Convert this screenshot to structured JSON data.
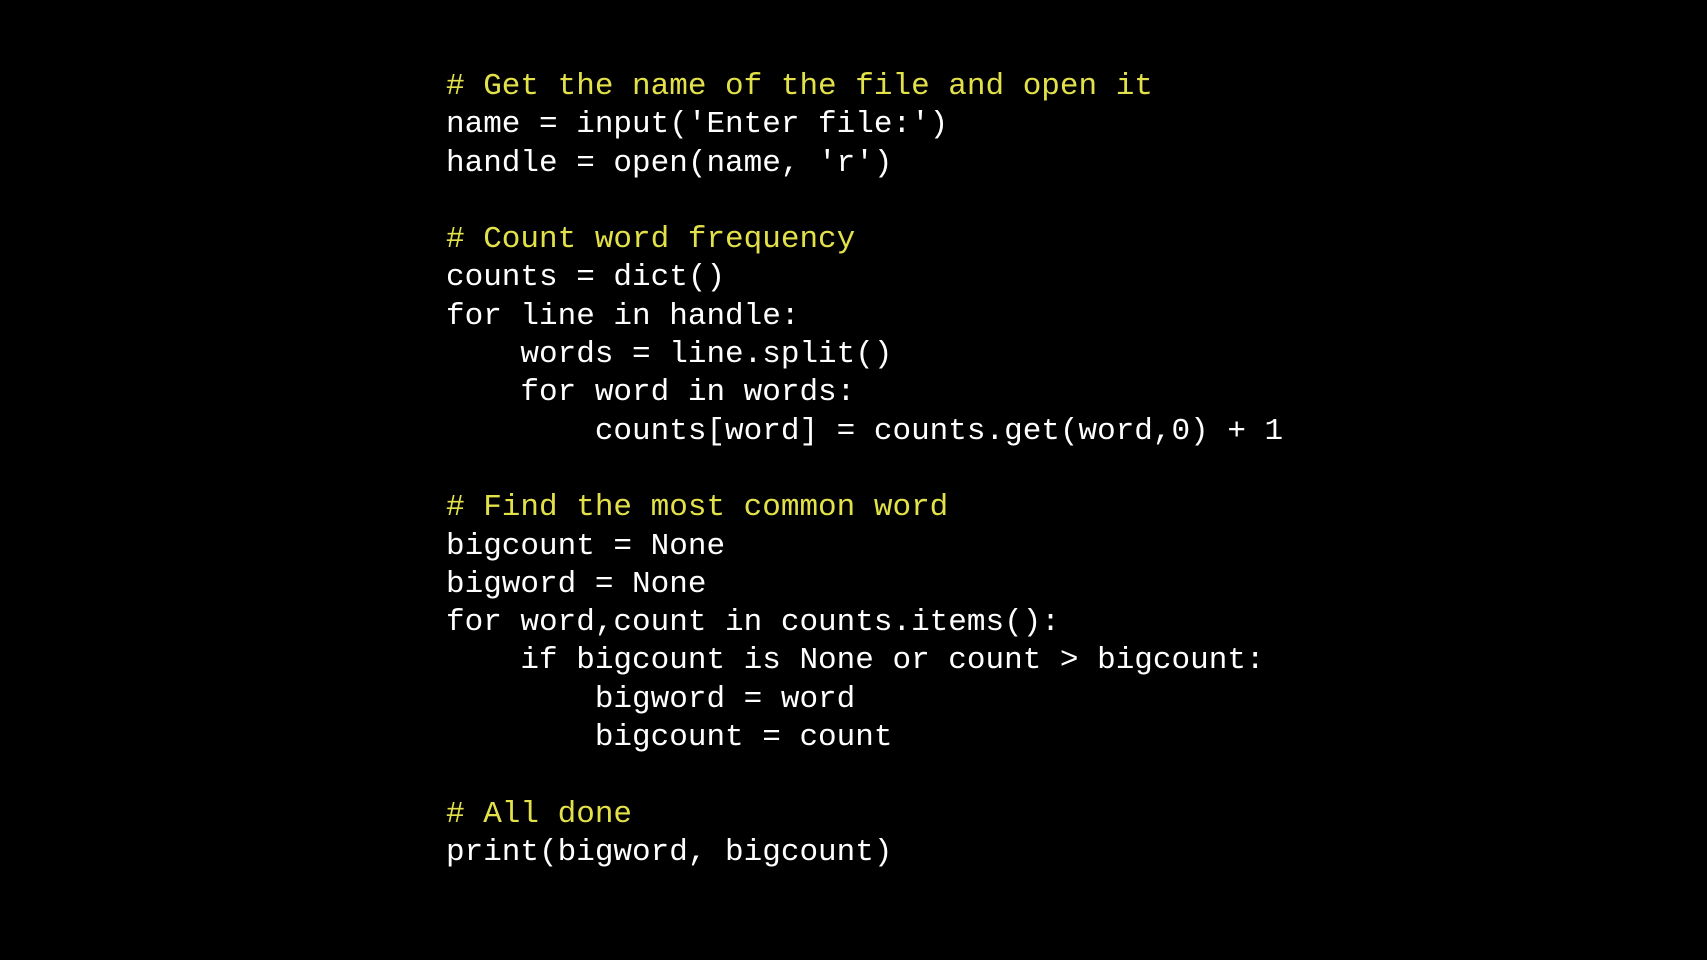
{
  "colors": {
    "background": "#000000",
    "code_text": "#ffffff",
    "comment_text": "#e2e14a"
  },
  "code_lines": [
    {
      "type": "comment",
      "text": "# Get the name of the file and open it"
    },
    {
      "type": "code",
      "text": "name = input('Enter file:')"
    },
    {
      "type": "code",
      "text": "handle = open(name, 'r')"
    },
    {
      "type": "blank",
      "text": ""
    },
    {
      "type": "comment",
      "text": "# Count word frequency"
    },
    {
      "type": "code",
      "text": "counts = dict()"
    },
    {
      "type": "code",
      "text": "for line in handle:"
    },
    {
      "type": "code",
      "text": "    words = line.split()"
    },
    {
      "type": "code",
      "text": "    for word in words:"
    },
    {
      "type": "code",
      "text": "        counts[word] = counts.get(word,0) + 1"
    },
    {
      "type": "blank",
      "text": ""
    },
    {
      "type": "comment",
      "text": "# Find the most common word"
    },
    {
      "type": "code",
      "text": "bigcount = None"
    },
    {
      "type": "code",
      "text": "bigword = None"
    },
    {
      "type": "code",
      "text": "for word,count in counts.items():"
    },
    {
      "type": "code",
      "text": "    if bigcount is None or count > bigcount:"
    },
    {
      "type": "code",
      "text": "        bigword = word"
    },
    {
      "type": "code",
      "text": "        bigcount = count"
    },
    {
      "type": "blank",
      "text": ""
    },
    {
      "type": "comment",
      "text": "# All done"
    },
    {
      "type": "code",
      "text": "print(bigword, bigcount)"
    }
  ]
}
